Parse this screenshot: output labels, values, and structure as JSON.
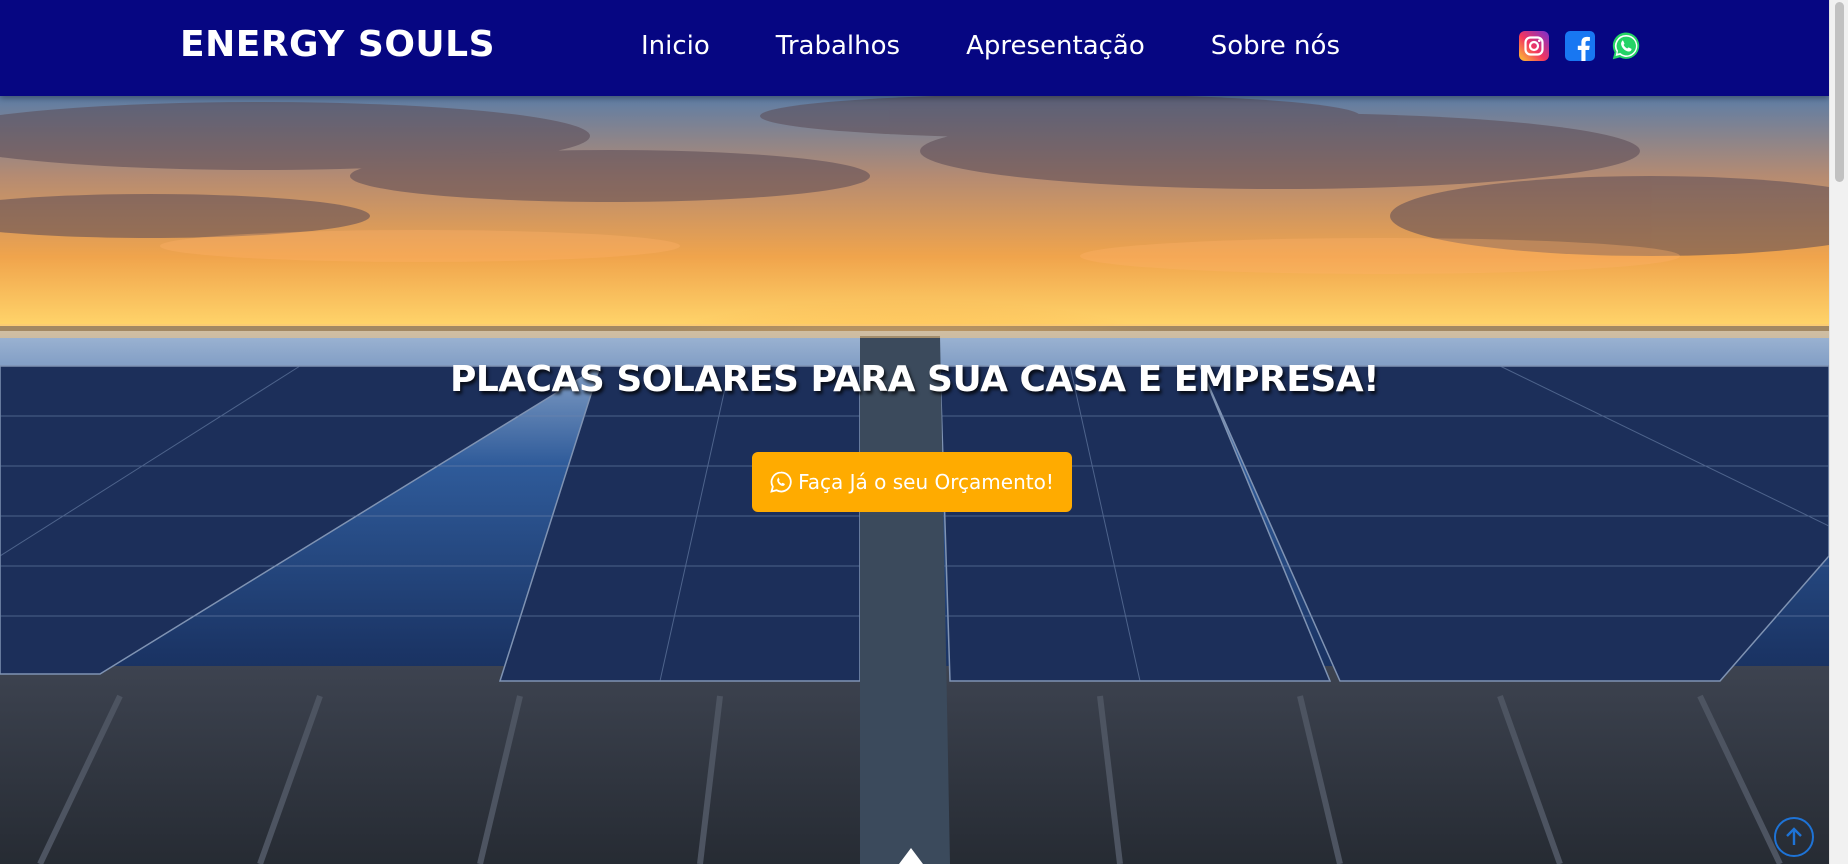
{
  "header": {
    "brand": "ENERGY SOULS",
    "nav": [
      {
        "label": "Inicio"
      },
      {
        "label": "Trabalhos"
      },
      {
        "label": "Apresentação"
      },
      {
        "label": "Sobre nós"
      }
    ],
    "socials": [
      {
        "name": "instagram-icon",
        "color": "#d6249f"
      },
      {
        "name": "facebook-icon",
        "color": "#1877f2"
      },
      {
        "name": "whatsapp-icon",
        "color": "#25d366"
      }
    ],
    "background": "#060682"
  },
  "hero": {
    "title": "PLACAS SOLARES PARA SUA CASA E EMPRESA!",
    "cta_label": "Faça Já o seu Orçamento!",
    "cta_icon": "whatsapp-icon",
    "cta_color": "#ffab00"
  },
  "back_to_top": {
    "icon": "arrow-up-icon",
    "color": "#1e73d6"
  }
}
